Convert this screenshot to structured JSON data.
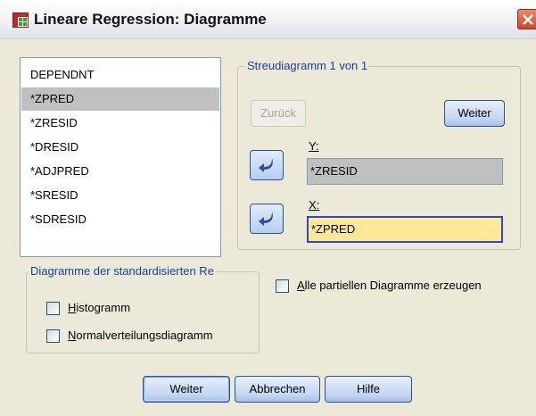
{
  "window": {
    "title": "Lineare Regression: Diagramme"
  },
  "variables": {
    "items": [
      {
        "label": "DEPENDNT",
        "selected": false
      },
      {
        "label": "*ZPRED",
        "selected": true
      },
      {
        "label": "*ZRESID",
        "selected": false
      },
      {
        "label": "*DRESID",
        "selected": false
      },
      {
        "label": "*ADJPRED",
        "selected": false
      },
      {
        "label": "*SRESID",
        "selected": false
      },
      {
        "label": "*SDRESID",
        "selected": false
      }
    ]
  },
  "scatter": {
    "legend": "Streudiagramm 1  von 1",
    "back_label": "Zurück",
    "next_label": "Weiter",
    "y_label": "Y:",
    "y_value": "*ZRESID",
    "x_label": "X:",
    "x_value": "*ZPRED"
  },
  "standardized": {
    "legend": "Diagramme der standardisierten Re",
    "histogram_label": "Histogramm",
    "histogram_checked": false,
    "normal_label": "Normalverteilungsdiagramm",
    "normal_checked": false
  },
  "partial": {
    "label": "Alle partiellen Diagramme erzeugen",
    "checked": false
  },
  "buttons": {
    "continue": "Weiter",
    "cancel": "Abbrechen",
    "help": "Hilfe"
  },
  "colors": {
    "accent": "#3048b8",
    "selection": "#c0c0c0",
    "target_highlight": "#ffe89a",
    "legend_text": "#1a3ea0"
  }
}
